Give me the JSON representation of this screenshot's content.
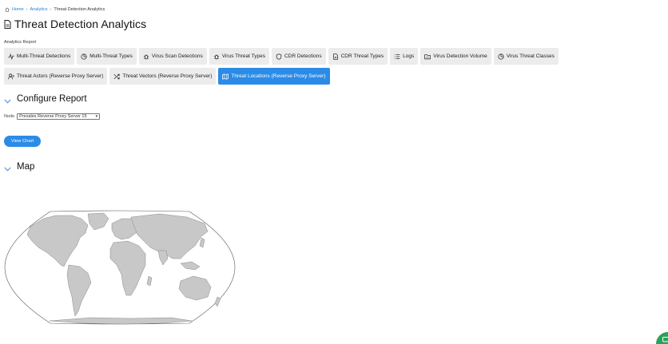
{
  "breadcrumb": {
    "home": "Home",
    "analytics": "Analytics",
    "current": "Threat Detection Analytics",
    "separator": "›"
  },
  "page": {
    "title": "Threat Detection Analytics",
    "section_label": "Analytics Report"
  },
  "tabs": [
    {
      "label": "Multi-Threat Detections",
      "icon": "activity-icon",
      "active": false
    },
    {
      "label": "Multi-Threat Types",
      "icon": "pie-chart-icon",
      "active": false
    },
    {
      "label": "Virus Scan Detections",
      "icon": "bug-icon",
      "active": false
    },
    {
      "label": "Virus Threat Types",
      "icon": "bug-icon",
      "active": false
    },
    {
      "label": "CDR Detections",
      "icon": "shield-icon",
      "active": false
    },
    {
      "label": "CDR Threat Types",
      "icon": "file-icon",
      "active": false
    },
    {
      "label": "Logs",
      "icon": "list-icon",
      "active": false
    },
    {
      "label": "Virus Detection Volume",
      "icon": "folder-icon",
      "active": false
    },
    {
      "label": "Virus Threat Classes",
      "icon": "pie-chart-icon",
      "active": false
    },
    {
      "label": "Threat Actors (Reverse Proxy Server)",
      "icon": "user-plus-icon",
      "active": false
    },
    {
      "label": "Threat Vectors (Reverse Proxy Server)",
      "icon": "shuffle-icon",
      "active": false
    },
    {
      "label": "Threat Locations (Reverse Proxy Server)",
      "icon": "map-icon",
      "active": true
    }
  ],
  "configure": {
    "heading": "Configure Report",
    "node_label": "Node",
    "node_value": "Presales Reverse Proxy Server 15",
    "view_button": "View Chart"
  },
  "map_section": {
    "heading": "Map"
  },
  "colors": {
    "accent": "#2b8be6",
    "tab_bg": "#ececec",
    "land": "#c8c8c8",
    "chat": "#27a35a"
  }
}
